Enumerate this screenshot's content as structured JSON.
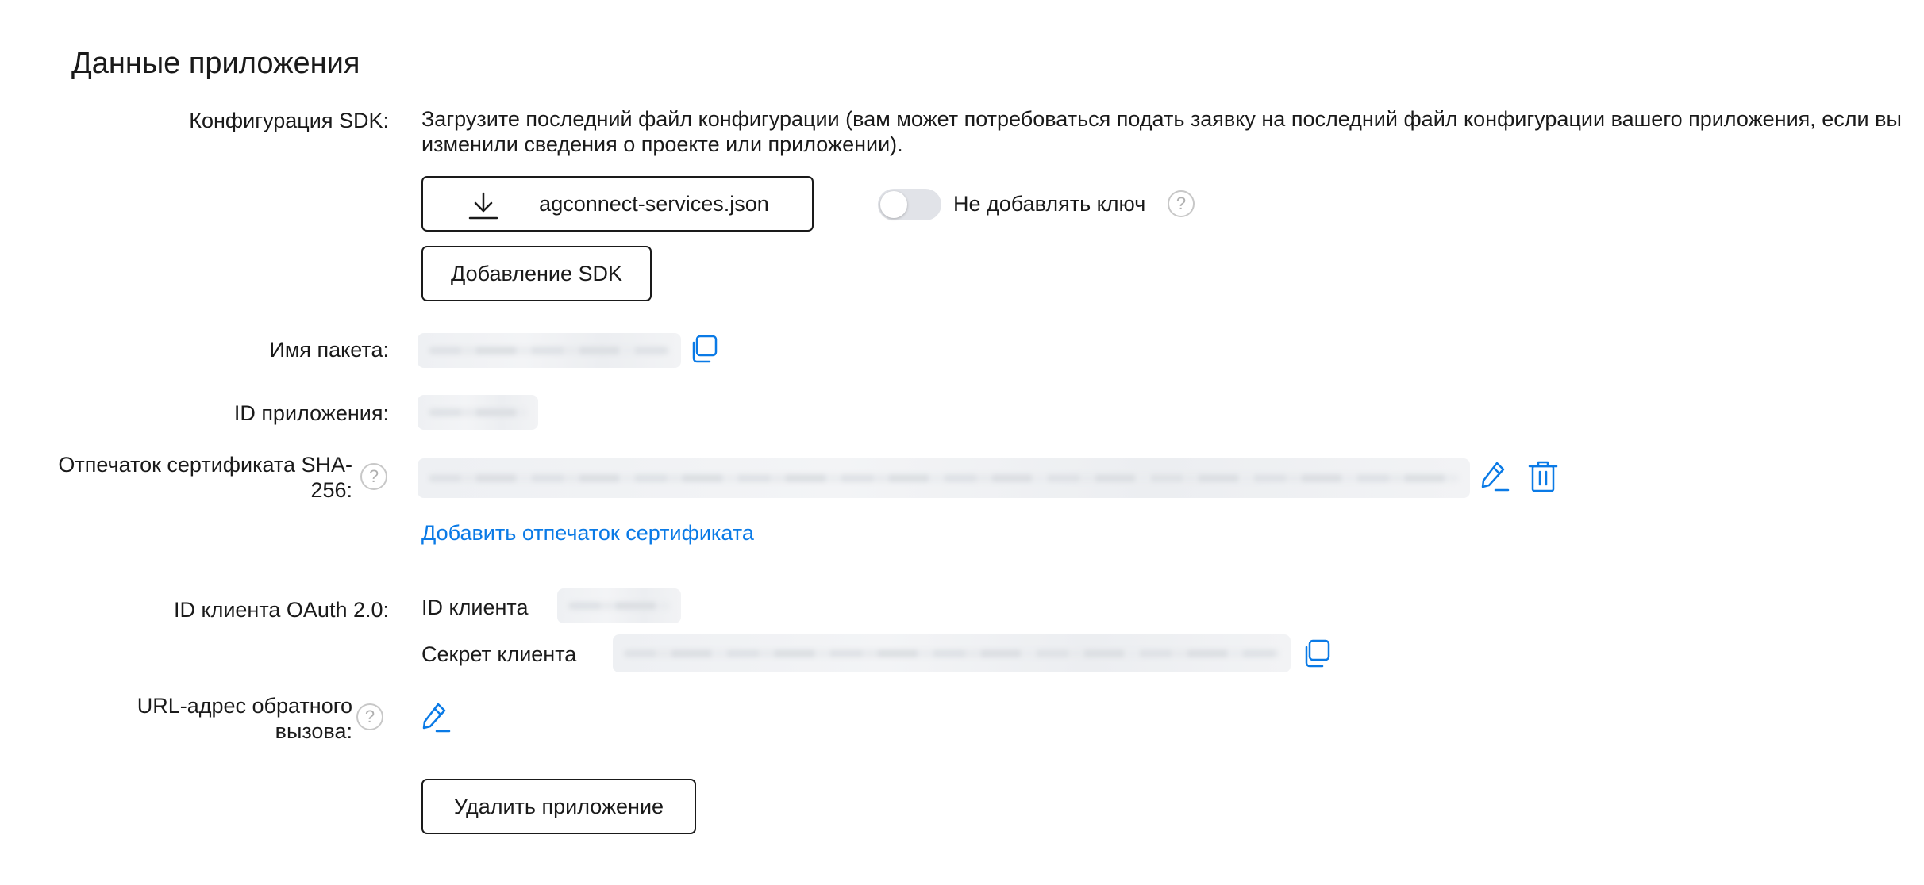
{
  "section": {
    "title": "Данные приложения"
  },
  "sdk": {
    "label": "Конфигурация SDK:",
    "description": "Загрузите последний файл конфигурации (вам может потребоваться подать заявку на последний файл конфигурации вашего приложения, если вы изменили сведения о проекте или приложении).",
    "download_label": "agconnect-services.json",
    "download_icon": "download-icon",
    "toggle_label": "Не добавлять ключ",
    "toggle_on": false,
    "add_sdk_label": "Добавление SDK"
  },
  "package": {
    "label": "Имя пакета:",
    "copy_icon": "copy-icon"
  },
  "app_id": {
    "label": "ID приложения:"
  },
  "certificate": {
    "label": "Отпечаток сертификата SHA-256:",
    "edit_icon": "edit-icon",
    "delete_icon": "trash-icon",
    "add_link": "Добавить отпечаток сертификата"
  },
  "oauth": {
    "label": "ID клиента OAuth 2.0:",
    "client_id_label": "ID клиента",
    "client_secret_label": "Секрет клиента",
    "copy_icon": "copy-icon"
  },
  "callback": {
    "label": "URL-адрес обратного вызова:",
    "edit_icon": "edit-icon"
  },
  "delete_app": {
    "label": "Удалить приложение"
  },
  "colors": {
    "accent": "#0a7ae6",
    "text": "#1a1a1a",
    "toggle_off": "#e1e3e8",
    "help": "#c8c8c8"
  }
}
